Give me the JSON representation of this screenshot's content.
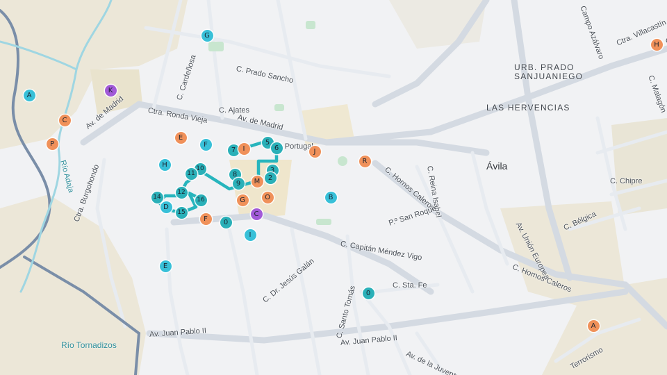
{
  "map": {
    "city_label": "Ávila",
    "district_labels": [
      {
        "id": "urb-prado",
        "lines": [
          "URB. PRADO",
          "SANJUANIEGO"
        ]
      },
      {
        "id": "hervencias",
        "lines": [
          "LAS HERVENCIAS"
        ]
      }
    ],
    "street_labels": [
      "C. Prado Sancho",
      "C. Cardeñosa",
      "C. Ajates",
      "Ctra. Ronda Vieja",
      "Av. de Madrid",
      "Av. de Madrid",
      "A Portugal",
      "Ctra. Burgohondo",
      "C. Hornos Caleros",
      "C. Reina Isabel",
      "P.º San Roque",
      "C. Capitán Méndez Vigo",
      "C. Dr. Jesús Galán",
      "C. Santo Tomás",
      "C. Sta. Fe",
      "Av. Juan Pablo II",
      "Av. Juan Pablo II",
      "Av. de la Juventud",
      "Av. Unión Europea",
      "C. Bélgica",
      "C. Chipre",
      "C. Hornos Caleros",
      "Ctra. Villacastín",
      "Campo Azálvaro",
      "Terrorismo",
      "Ctra. Villacastín",
      "C. Malagón"
    ],
    "river_labels": [
      "Río Adaja",
      "Río Tornadizos"
    ],
    "markers": [
      {
        "label": "A",
        "color": "cyan"
      },
      {
        "label": "G",
        "color": "cyan"
      },
      {
        "label": "K",
        "color": "purple"
      },
      {
        "label": "C",
        "color": "orange"
      },
      {
        "label": "P",
        "color": "orange"
      },
      {
        "label": "E",
        "color": "orange"
      },
      {
        "label": "F",
        "color": "cyan"
      },
      {
        "label": "H",
        "color": "cyan"
      },
      {
        "label": "7",
        "color": "teal"
      },
      {
        "label": "I",
        "color": "orange"
      },
      {
        "label": "5",
        "color": "teal"
      },
      {
        "label": "6",
        "color": "teal"
      },
      {
        "label": "J",
        "color": "orange"
      },
      {
        "label": "R",
        "color": "orange"
      },
      {
        "label": "10",
        "color": "teal"
      },
      {
        "label": "11",
        "color": "teal"
      },
      {
        "label": "8",
        "color": "teal"
      },
      {
        "label": "9",
        "color": "teal"
      },
      {
        "label": "3",
        "color": "teal"
      },
      {
        "label": "2",
        "color": "teal"
      },
      {
        "label": "M",
        "color": "orange"
      },
      {
        "label": "12",
        "color": "teal"
      },
      {
        "label": "14",
        "color": "teal"
      },
      {
        "label": "16",
        "color": "teal"
      },
      {
        "label": "D",
        "color": "cyan"
      },
      {
        "label": "15",
        "color": "teal"
      },
      {
        "label": "F",
        "color": "orange"
      },
      {
        "label": "0",
        "color": "teal"
      },
      {
        "label": "G",
        "color": "orange"
      },
      {
        "label": "O",
        "color": "orange"
      },
      {
        "label": "C",
        "color": "purple"
      },
      {
        "label": "B",
        "color": "cyan"
      },
      {
        "label": "I",
        "color": "cyan"
      },
      {
        "label": "E",
        "color": "cyan"
      },
      {
        "label": "0",
        "color": "teal"
      },
      {
        "label": "H",
        "color": "orange"
      },
      {
        "label": "A",
        "color": "orange"
      }
    ]
  }
}
